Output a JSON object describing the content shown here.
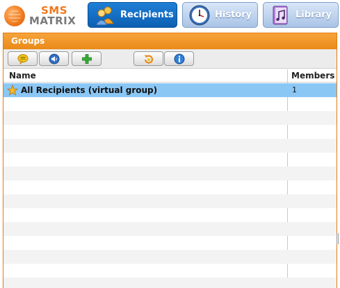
{
  "app": {
    "logo_line1": "SMS",
    "logo_line2": "MATRIX"
  },
  "nav": {
    "recipients": "Recipients",
    "history": "History",
    "library": "Library"
  },
  "panel": {
    "title": "Groups",
    "toolbar": [
      {
        "icon": "speech-bubble-icon"
      },
      {
        "icon": "speaker-icon"
      },
      {
        "icon": "add-icon"
      },
      {
        "icon": "refresh-icon"
      },
      {
        "icon": "info-icon"
      }
    ],
    "columns": {
      "name": "Name",
      "members": "Members"
    },
    "rows": [
      {
        "name": "All Recipients (virtual group)",
        "members": "1",
        "icon": "star-icon",
        "selected": true
      }
    ]
  },
  "colors": {
    "accent_orange": "#e98a18",
    "active_tab": "#0c5fb3",
    "selection": "#8ac7f5"
  }
}
